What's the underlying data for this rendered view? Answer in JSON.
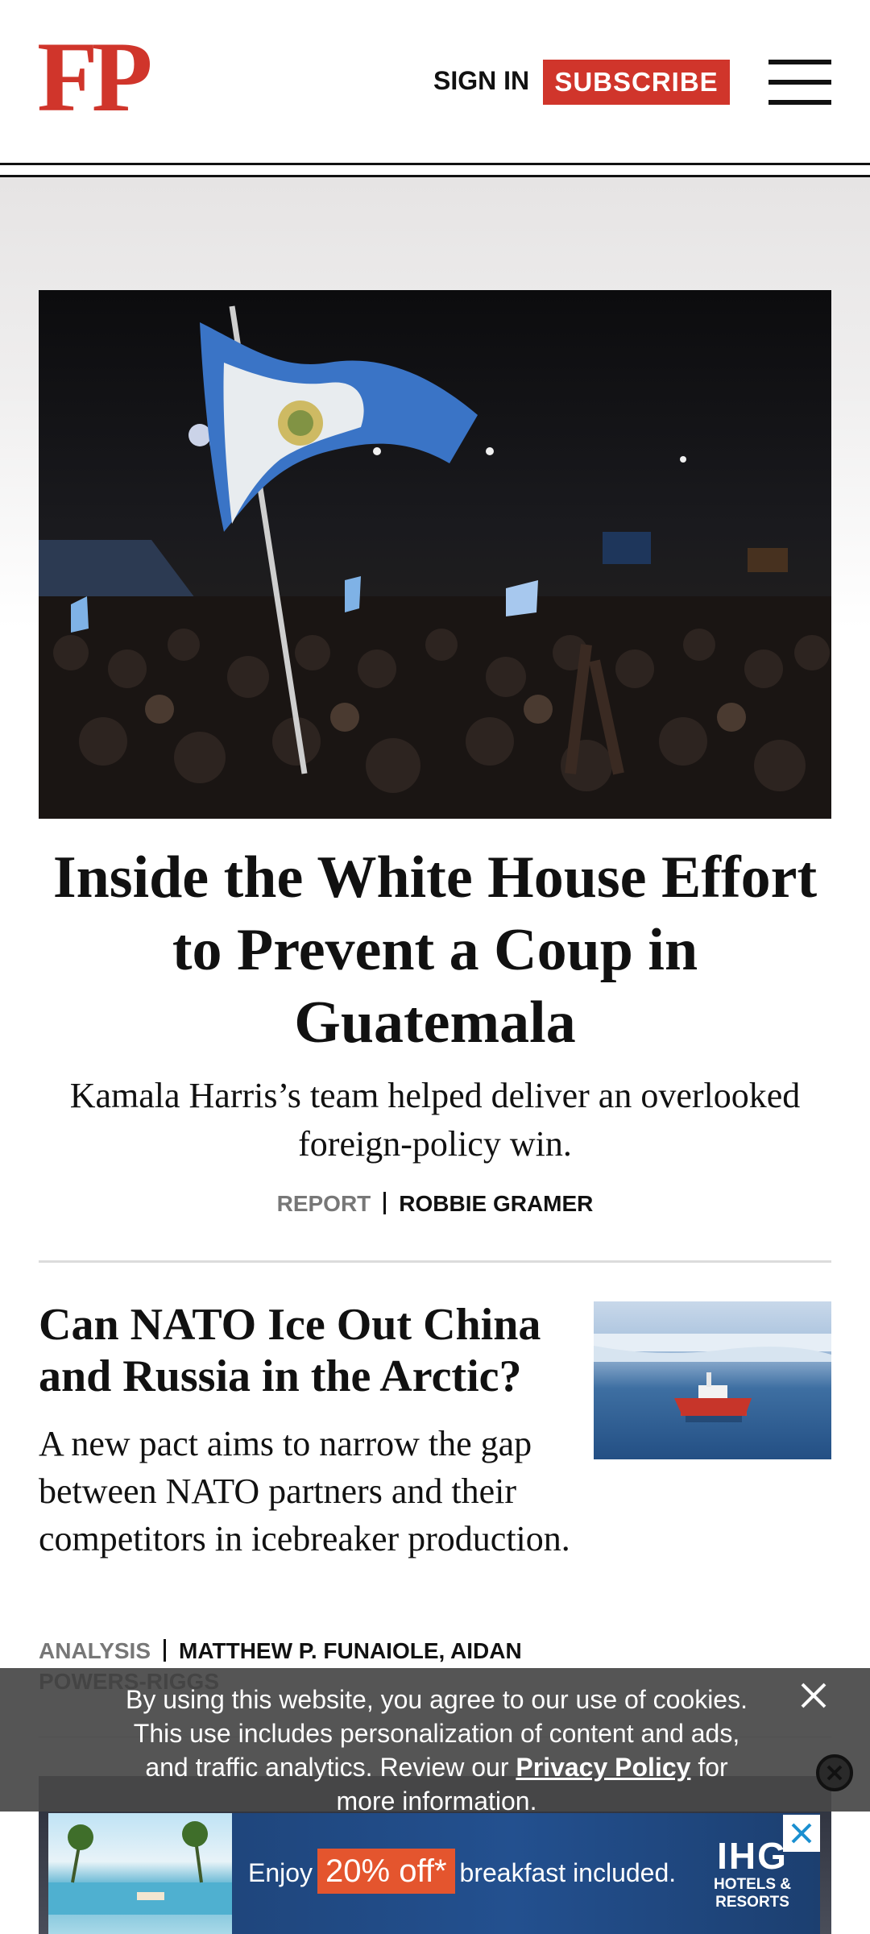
{
  "header": {
    "logo": "FP",
    "signin_label": "SIGN IN",
    "subscribe_label": "SUBSCRIBE",
    "menu_icon": "hamburger-menu-icon"
  },
  "lead_story": {
    "title": "Inside the White House Effort to Prevent a Coup in Guatemala",
    "dek": "Kamala Harris’s team helped deliver an overlooked foreign-policy win.",
    "kicker": "REPORT",
    "author": "ROBBIE GRAMER"
  },
  "second_story": {
    "title": "Can NATO Ice Out China and Russia in the Arctic?",
    "dek": "A new pact aims to narrow the gap between NATO partners and their competitors in icebreaker production.",
    "kicker": "ANALYSIS",
    "author": "MATTHEW P. FUNAIOLE, AIDAN POWERS-RIGGS"
  },
  "cookie_banner": {
    "text_before": "By using this website, you agree to our use of cookies. This use includes personalization of content and ads, and traffic analytics. Review our ",
    "link": "Privacy Policy",
    "text_after": " for more information."
  },
  "ad": {
    "enjoy": "Enjoy",
    "badge": "20% off*",
    "rest": "breakfast included.",
    "brand": "IHG",
    "brand_sub1": "HOTELS &",
    "brand_sub2": "RESORTS"
  },
  "colors": {
    "brand_red": "#d0352b",
    "kicker_gray": "#777777"
  }
}
